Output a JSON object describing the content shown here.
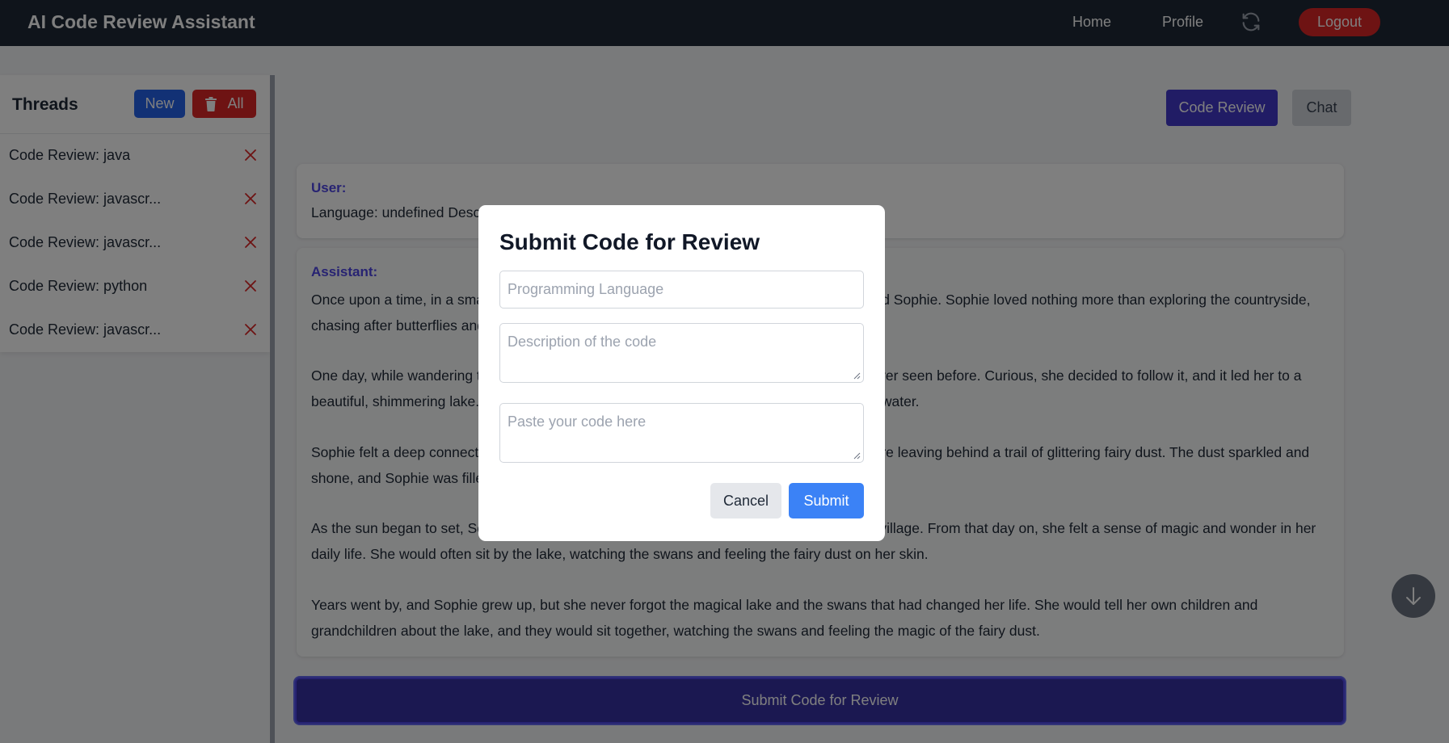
{
  "navbar": {
    "brand": "AI Code Review Assistant",
    "home": "Home",
    "profile": "Profile",
    "refresh_icon": "refresh-icon",
    "logout": "Logout"
  },
  "sidebar": {
    "title": "Threads",
    "new_label": "New",
    "all_label": "All",
    "threads": [
      {
        "label": "Code Review: java"
      },
      {
        "label": "Code Review: javascr..."
      },
      {
        "label": "Code Review: javascr..."
      },
      {
        "label": "Code Review: python"
      },
      {
        "label": "Code Review: javascr..."
      }
    ]
  },
  "tabs": {
    "code_review": "Code Review",
    "chat": "Chat"
  },
  "messages": {
    "user_role": "User:",
    "user_text": "Language: undefined Description",
    "assistant_role": "Assistant:",
    "paragraphs": [
      "Once upon a time, in a small village nestled in the rolling hills, there lived a young girl named Sophie. Sophie loved nothing more than exploring the countryside, chasing after butterflies and picking wildflowers.",
      "One day, while wandering through the meadows, Sophie stumbled upon a path she had never seen before. Curious, she decided to follow it, and it led her to a beautiful, shimmering lake. On the lake, graceful swans were gliding effortlessly across the water.",
      "Sophie felt a deep connection to the swans as she watched them. She noticed that they were leaving behind a trail of glittering fairy dust. The dust sparkled and shone, and Sophie was filled with wonder.",
      "As the sun began to set, Sophie reluctantly said goodbye to the swans and returned to her village. From that day on, she felt a sense of magic and wonder in her daily life. She would often sit by the lake, watching the swans and feeling the fairy dust on her skin.",
      "Years went by, and Sophie grew up, but she never forgot the magical lake and the swans that had changed her life. She would tell her own children and grandchildren about the lake, and they would sit together, watching the swans and feeling the magic of the fairy dust."
    ]
  },
  "submit_review_label": "Submit Code for Review",
  "modal": {
    "title": "Submit Code for Review",
    "language_placeholder": "Programming Language",
    "description_placeholder": "Description of the code",
    "code_placeholder": "Paste your code here",
    "cancel": "Cancel",
    "submit": "Submit"
  },
  "colors": {
    "navbar_bg": "#1f2937",
    "primary_indigo": "#4338ca",
    "danger": "#dc2626",
    "blue": "#2563eb",
    "overlay": "rgba(0,0,0,0.5)"
  }
}
